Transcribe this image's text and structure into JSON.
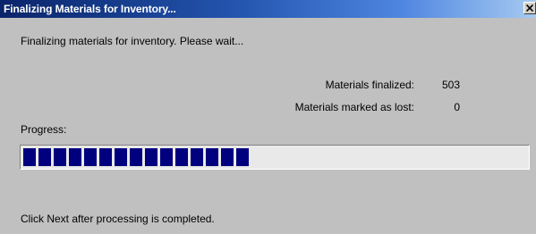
{
  "window": {
    "title": "Finalizing Materials for Inventory..."
  },
  "main": {
    "status_message": "Finalizing materials for inventory.  Please wait...",
    "stats": [
      {
        "label": "Materials finalized:",
        "value": "503"
      },
      {
        "label": "Materials marked as lost:",
        "value": "0"
      }
    ],
    "progress_label": "Progress:",
    "progress_fraction": 0.45,
    "footer_message": "Click Next after processing is completed."
  },
  "colors": {
    "titlebar_start": "#0a246a",
    "titlebar_end": "#a6caf0",
    "dialog_bg": "#c0c0c0",
    "progress_fill": "#00007f"
  },
  "icons": {
    "close": "close-icon"
  }
}
